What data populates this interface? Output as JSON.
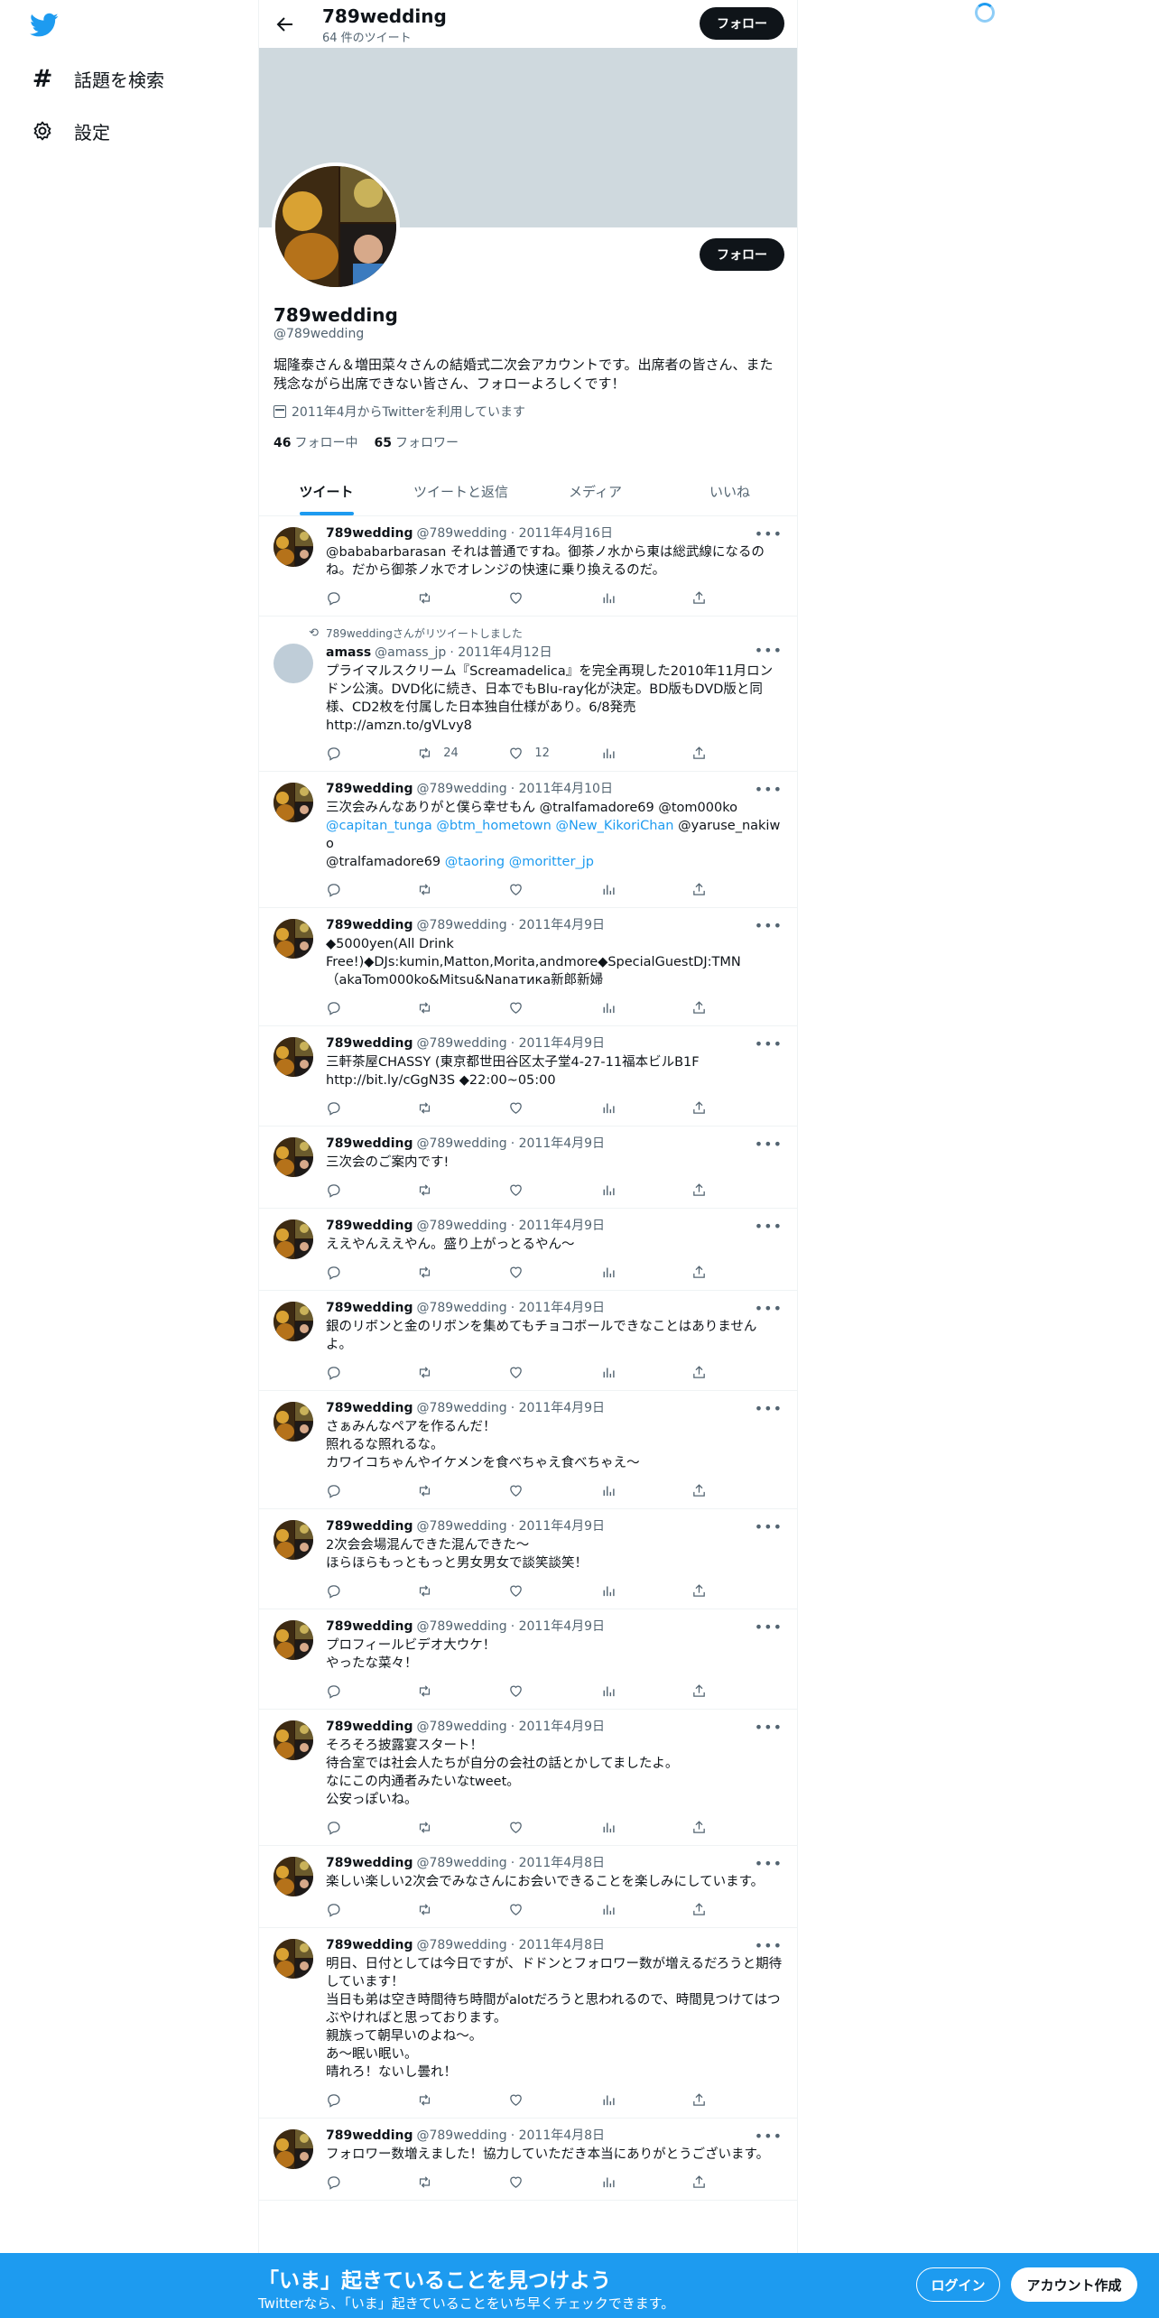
{
  "sidebar": {
    "logo": "twitter-bird-icon",
    "items": [
      {
        "icon": "hashtag-icon",
        "label": "話題を検索"
      },
      {
        "icon": "gear-icon",
        "label": "設定"
      }
    ]
  },
  "header": {
    "name": "789wedding",
    "tweet_count": "64 件のツイート",
    "follow_label": "フォロー"
  },
  "profile": {
    "name": "789wedding",
    "handle": "@789wedding",
    "follow_label": "フォロー",
    "bio": "堀隆泰さん＆増田菜々さんの結婚式二次会アカウントです。出席者の皆さん、また残念ながら出席できない皆さん、フォローよろしくです！",
    "joined": "2011年4月からTwitterを利用しています",
    "following_count": "46",
    "following_label": "フォロー中",
    "followers_count": "65",
    "followers_label": "フォロワー"
  },
  "tabs": [
    "ツイート",
    "ツイートと返信",
    "メディア",
    "いいね"
  ],
  "tweets": [
    {
      "name": "789wedding",
      "handle": "@789wedding",
      "date": "· 2011年4月16日",
      "text": "@bababarbarasan それは普通ですね。御茶ノ水から東は総武線になるのね。だから御茶ノ水でオレンジの快速に乗り換えるのだ。"
    },
    {
      "retweeted_by": "789weddingさんがリツイートしました",
      "name": "amass",
      "handle": "@amass_jp",
      "date": "· 2011年4月12日",
      "text": "プライマルスクリーム『Screamadelica』を完全再現した2010年11月ロンドン公演。DVD化に続き、日本でもBlu-ray化が決定。BD版もDVD版と同様、CD2枚を付属した日本独自仕様があり。6/8発売\nhttp://amzn.to/gVLvy8",
      "retweets": "24",
      "likes": "12"
    },
    {
      "name": "789wedding",
      "handle": "@789wedding",
      "date": "· 2011年4月10日",
      "text_parts": [
        {
          "t": "三次会みんなありがと僕ら幸せもん @tralfamadore69 @tom000ko\n"
        },
        {
          "t": "@capitan_tunga @btm_hometown @New_KikoriChan",
          "m": true
        },
        {
          "t": " @yaruse_nakiwo\n@tralfamadore69 "
        },
        {
          "t": "@taoring @moritter_jp",
          "m": true
        }
      ]
    },
    {
      "name": "789wedding",
      "handle": "@789wedding",
      "date": "· 2011年4月9日",
      "text": "◆5000yen(All Drink\nFree!)◆DJs:kumin,Matton,Morita,andmore◆SpecialGuestDJ:TMN\n（akaTom000ko&Mitsu&Nanатика新郎新婦"
    },
    {
      "name": "789wedding",
      "handle": "@789wedding",
      "date": "· 2011年4月9日",
      "text": "三軒茶屋CHASSY (東京都世田谷区太子堂4-27-11福本ビルB1F\nhttp://bit.ly/cGgN3S ◆22:00~05:00"
    },
    {
      "name": "789wedding",
      "handle": "@789wedding",
      "date": "· 2011年4月9日",
      "text": "三次会のご案内です!"
    },
    {
      "name": "789wedding",
      "handle": "@789wedding",
      "date": "· 2011年4月9日",
      "text": "ええやんええやん。盛り上がっとるやん～"
    },
    {
      "name": "789wedding",
      "handle": "@789wedding",
      "date": "· 2011年4月9日",
      "text": "銀のリボンと金のリボンを集めてもチョコボールできなことはありませんよ。"
    },
    {
      "name": "789wedding",
      "handle": "@789wedding",
      "date": "· 2011年4月9日",
      "text": "さぁみんなペアを作るんだ！\n照れるな照れるな。\nカワイコちゃんやイケメンを食べちゃえ食べちゃえ～"
    },
    {
      "name": "789wedding",
      "handle": "@789wedding",
      "date": "· 2011年4月9日",
      "text": "2次会会場混んできた混んできた～\nほらほらもっともっと男女男女で談笑談笑！"
    },
    {
      "name": "789wedding",
      "handle": "@789wedding",
      "date": "· 2011年4月9日",
      "text": "プロフィールビデオ大ウケ！\nやったな菜々！"
    },
    {
      "name": "789wedding",
      "handle": "@789wedding",
      "date": "· 2011年4月9日",
      "text": "そろそろ披露宴スタート！\n待合室では社会人たちが自分の会社の話とかしてましたよ。\nなにこの内通者みたいなtweet。\n公安っぽいね。"
    },
    {
      "name": "789wedding",
      "handle": "@789wedding",
      "date": "· 2011年4月8日",
      "text": "楽しい楽しい2次会でみなさんにお会いできることを楽しみにしています。"
    },
    {
      "name": "789wedding",
      "handle": "@789wedding",
      "date": "· 2011年4月8日",
      "text": "明日、日付としては今日ですが、ドドンとフォロワー数が増えるだろうと期待しています！\n当日も弟は空き時間待ち時間がalotだろうと思われるので、時間見つけてはつぶやければと思っております。\n親族って朝早いのよね〜。\nあ〜眠い眠い。\n晴れろ！ないし曇れ！"
    },
    {
      "name": "789wedding",
      "handle": "@789wedding",
      "date": "· 2011年4月8日",
      "text": "フォロワー数増えました！協力していただき本当にありがとうございます。"
    }
  ],
  "bottom_bar": {
    "title": "「いま」起きていることを見つけよう",
    "subtitle": "Twitterなら、「いま」起きていることをいち早くチェックできます。",
    "login": "ログイン",
    "signup": "アカウント作成"
  },
  "colors": {
    "accent": "#1d9bf0",
    "text": "#0f1419",
    "muted": "#536471",
    "banner": "#cfd9de"
  }
}
